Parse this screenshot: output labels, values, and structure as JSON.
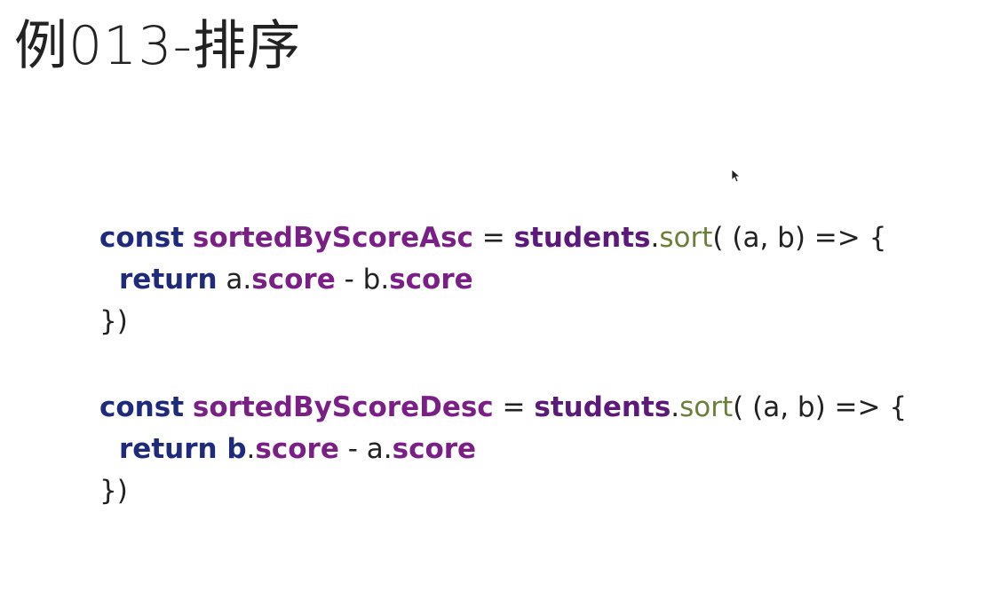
{
  "slide": {
    "title": "例013-排序"
  },
  "code": {
    "asc": {
      "line1": {
        "kw": "const",
        "sp1": " ",
        "var": "sortedByScoreAsc",
        "eq": " = ",
        "obj": "students",
        "dot": ".",
        "fn": "sort",
        "rest": "( (a, b) => {"
      },
      "line2": {
        "kw": "return",
        "a": " a",
        "dot1": ".",
        "prop1": "score",
        "minus": " - ",
        "b": "b",
        "dot2": ".",
        "prop2": "score"
      },
      "line3": {
        "close": "})"
      }
    },
    "desc": {
      "line1": {
        "kw": "const",
        "sp1": " ",
        "var": "sortedByScoreDesc",
        "eq": " = ",
        "obj": "students",
        "dot": ".",
        "fn": "sort",
        "rest": "( (a, b) => {"
      },
      "line2": {
        "kw": "return",
        "b": " b",
        "dot1": ".",
        "prop1": "score",
        "minus": " - ",
        "a": "a",
        "dot2": ".",
        "prop2": "score"
      },
      "line3": {
        "close": "})"
      }
    }
  },
  "colors": {
    "keyword": "#1f2a7a",
    "variable": "#7a1f86",
    "method": "#6b7f3a",
    "text": "#222222"
  },
  "icons": {
    "cursor": "mouse-pointer-icon"
  }
}
